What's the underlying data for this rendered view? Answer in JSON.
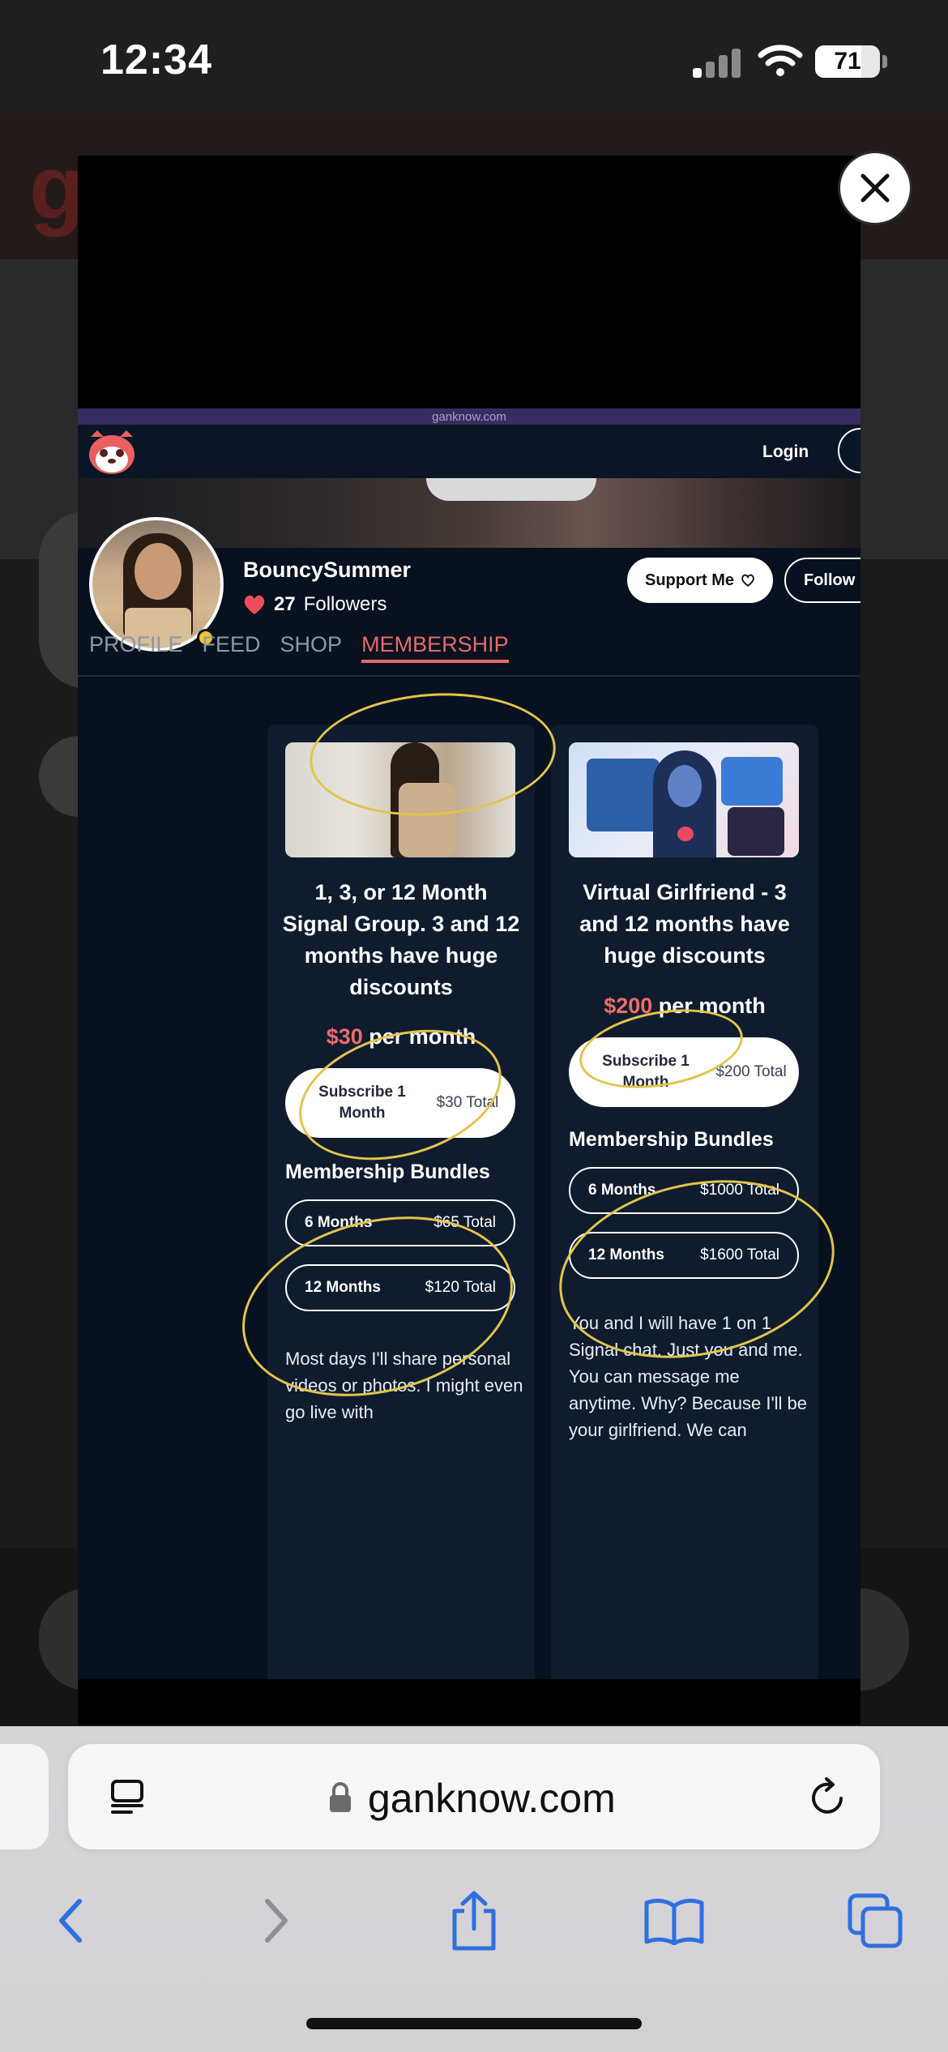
{
  "status_bar": {
    "time": "12:34",
    "battery": "71"
  },
  "browser": {
    "url": "ganknow.com"
  },
  "site": {
    "top_banner_text": "ganknow.com",
    "login": "Login",
    "profile": {
      "username": "BouncySummer",
      "followers_count": "27",
      "followers_label": "Followers",
      "support_button": "Support Me",
      "follow_button": "Follow"
    },
    "tabs": [
      "PROFILE",
      "FEED",
      "SHOP",
      "MEMBERSHIP"
    ],
    "active_tab": "MEMBERSHIP"
  },
  "membership": [
    {
      "title": "1, 3, or 12 Month Signal Group. 3 and 12 months have huge discounts",
      "price": "$30",
      "price_suffix": "per month",
      "subscribe_label": "Subscribe 1 Month",
      "subscribe_total": "$30 Total",
      "bundles_title": "Membership Bundles",
      "bundles": [
        {
          "name": "6 Months",
          "total": "$65 Total"
        },
        {
          "name": "12 Months",
          "total": "$120 Total"
        }
      ],
      "description": "Most days I'll share personal videos or photos. I might even go live with"
    },
    {
      "title": "Virtual Girlfriend - 3 and 12 months have huge discounts",
      "price": "$200",
      "price_suffix": "per month",
      "subscribe_label": "Subscribe 1 Month",
      "subscribe_total": "$200 Total",
      "bundles_title": "Membership Bundles",
      "bundles": [
        {
          "name": "6 Months",
          "total": "$1000 Total"
        },
        {
          "name": "12 Months",
          "total": "$1600 Total"
        }
      ],
      "description": "You and I will have 1 on 1 Signal chat. Just you and me. You can message me anytime. Why? Because I'll be your girlfriend. We can"
    }
  ],
  "colors": {
    "accent": "#ef6b6b",
    "annotation": "#e2c44a",
    "page_bg": "#07111f"
  }
}
